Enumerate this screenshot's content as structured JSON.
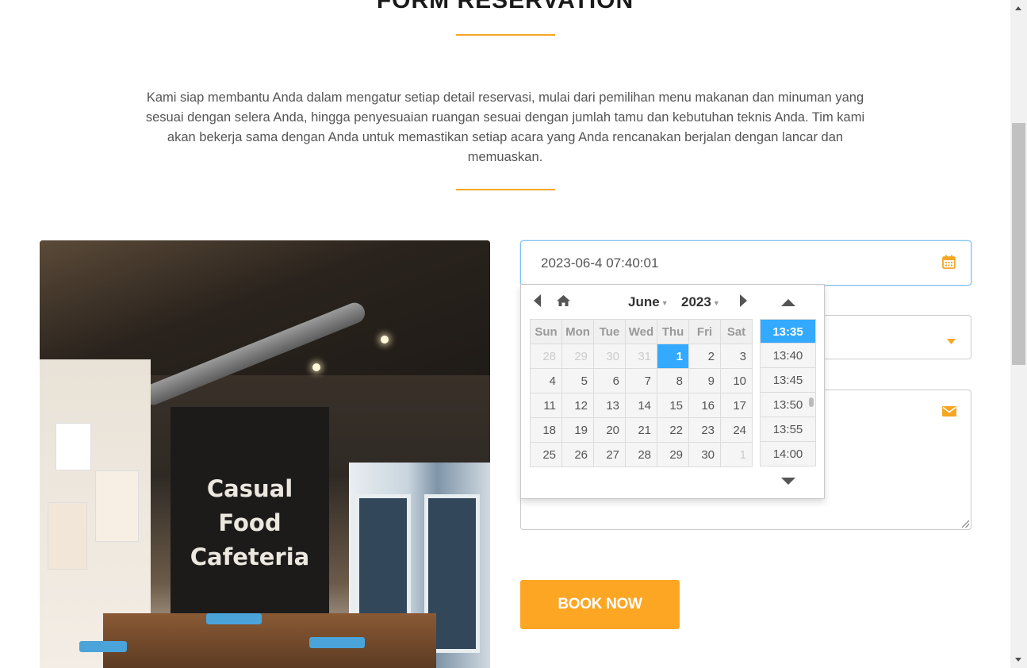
{
  "section": {
    "title": "FORM RESERVATION",
    "intro": "Kami siap membantu Anda dalam mengatur setiap detail reservasi, mulai dari pemilihan menu makanan dan minuman yang sesuai dengan selera Anda, hingga penyesuaian ruangan sesuai dengan jumlah tamu dan kebutuhan teknis Anda. Tim kami akan bekerja sama dengan Anda untuk memastikan setiap acara yang Anda rencanakan berjalan dengan lancar dan memuaskan."
  },
  "photo": {
    "sign_lines": [
      "Casual",
      "Food",
      "Cafeteria"
    ]
  },
  "form": {
    "date_value": "2023-06-4 07:40:01",
    "select_value": "",
    "message_value": "",
    "book_label": "BOOK NOW"
  },
  "datepicker": {
    "month": "June",
    "year": "2023",
    "weekdays": [
      "Sun",
      "Mon",
      "Tue",
      "Wed",
      "Thu",
      "Fri",
      "Sat"
    ],
    "weeks": [
      [
        "28",
        "29",
        "30",
        "31",
        "1",
        "2",
        "3"
      ],
      [
        "4",
        "5",
        "6",
        "7",
        "8",
        "9",
        "10"
      ],
      [
        "11",
        "12",
        "13",
        "14",
        "15",
        "16",
        "17"
      ],
      [
        "18",
        "19",
        "20",
        "21",
        "22",
        "23",
        "24"
      ],
      [
        "25",
        "26",
        "27",
        "28",
        "29",
        "30",
        "1"
      ]
    ],
    "selected_day": "1",
    "times": [
      "13:35",
      "13:40",
      "13:45",
      "13:50",
      "13:55",
      "14:00"
    ],
    "selected_time": "13:35"
  },
  "icons": {
    "calendar": "calendar-icon",
    "dropdown": "caret-down-icon",
    "message": "envelope-icon",
    "prev": "triangle-left-icon",
    "home": "home-icon",
    "next": "triangle-right-icon"
  },
  "colors": {
    "accent": "#f5a623",
    "button": "#fda624",
    "picker_current": "#33aaff",
    "focus_border": "#7fc3f0"
  }
}
